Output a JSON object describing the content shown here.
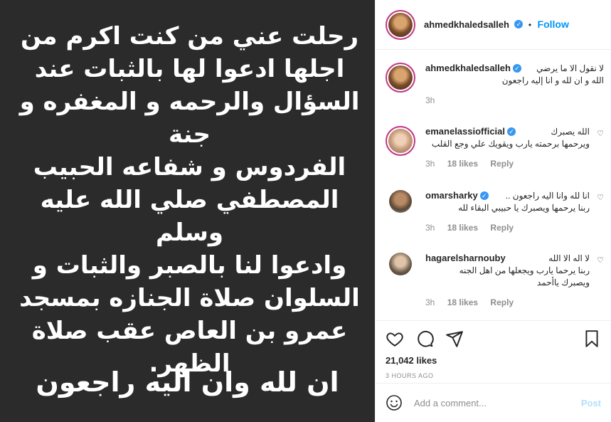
{
  "media": {
    "lines": [
      "رحلت عني من كنت اكرم من",
      "اجلها ادعوا لها بالثبات عند",
      "السؤال والرحمه و المغفره و جنة",
      "الفردوس و شفاعه الحبيب",
      "المصطفي صلي الله عليه وسلم",
      "وادعوا لنا بالصبر والثبات و",
      "السلوان صلاة الجنازه بمسجد",
      "عمرو بن العاص عقب صلاة",
      "الظهر."
    ],
    "footer": "ان لله وان اليه راجعون"
  },
  "header": {
    "username": "ahmedkhaledsalleh",
    "separator": "•",
    "follow_label": "Follow"
  },
  "comments": [
    {
      "username": "ahmedkhaledsalleh",
      "line1": "لا نقول الا ما يرضي",
      "line2": "الله و ان لله و انا إليه راجعون",
      "time": "3h"
    },
    {
      "username": "emanelassiofficial",
      "line1": "الله يصبرك",
      "line2": "ويرحمها برحمته يارب ويقويك علي وجع القلب",
      "time": "3h",
      "likes": "18 likes",
      "reply": "Reply"
    },
    {
      "username": "omarsharky",
      "line1": "انا لله وانا اليه راجعون ..",
      "line2": "ربنا يرحمها ويصبرك يا حبيبي البقاء لله",
      "time": "3h",
      "likes": "18 likes",
      "reply": "Reply"
    },
    {
      "username": "hagarelsharnouby",
      "line1": "لا اله الا الله",
      "line2": "ربنا يرحما يارب ويجعلها من اهل الجنه",
      "line3": "ويصبرك ياأحمد",
      "time": "3h",
      "likes": "18 likes",
      "reply": "Reply"
    }
  ],
  "actions": {
    "likes": "21,042 likes",
    "timestamp": "3 HOURS AGO"
  },
  "add_comment": {
    "placeholder": "Add a comment...",
    "post_label": "Post"
  },
  "colors": {
    "accent": "#0095f6",
    "media_bg": "#2b2b2b",
    "muted": "#8e8e8e"
  }
}
